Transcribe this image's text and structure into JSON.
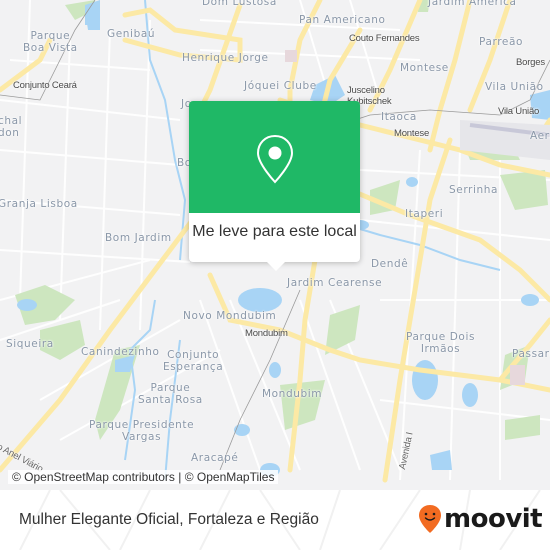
{
  "map": {
    "neighborhoods": [
      {
        "id": "dom-lustosa",
        "label": "Dom Lustosa"
      },
      {
        "id": "jardim-america",
        "label": "Jardim América"
      },
      {
        "id": "parque-boa-vista",
        "label": "Parque\nBoa Vista"
      },
      {
        "id": "genibau",
        "label": "Genibaú"
      },
      {
        "id": "pan-americano",
        "label": "Pan Americano"
      },
      {
        "id": "parreao",
        "label": "Parreão"
      },
      {
        "id": "henrique-jorge",
        "label": "Henrique Jorge"
      },
      {
        "id": "montese",
        "label": "Montese"
      },
      {
        "id": "joquei-clube",
        "label": "Jóquei Clube"
      },
      {
        "id": "vila-uniao",
        "label": "Vila União"
      },
      {
        "id": "itaoca",
        "label": "Itaoca"
      },
      {
        "id": "aeroporto",
        "label": "Aero"
      },
      {
        "id": "marechal-rondon",
        "label": "chal\ndon"
      },
      {
        "id": "serrinha",
        "label": "Serrinha"
      },
      {
        "id": "granja-lisboa",
        "label": "Granja Lisboa"
      },
      {
        "id": "itaperi",
        "label": "Itaperi"
      },
      {
        "id": "bom-jardim",
        "label": "Bom Jardim"
      },
      {
        "id": "dende",
        "label": "Dendê"
      },
      {
        "id": "jardim-cearense",
        "label": "Jardim Cearense"
      },
      {
        "id": "novo-mondubim",
        "label": "Novo Mondubim"
      },
      {
        "id": "parque-dois-irmaos",
        "label": "Parque Dois\nIrmãos"
      },
      {
        "id": "siqueira",
        "label": "Siqueira"
      },
      {
        "id": "canindezinho",
        "label": "Canindezinho"
      },
      {
        "id": "conjunto-esperanca",
        "label": "Conjunto\nEsperança"
      },
      {
        "id": "passare",
        "label": "Passare"
      },
      {
        "id": "parque-santa-rosa",
        "label": "Parque\nSanta Rosa"
      },
      {
        "id": "mondubim",
        "label": "Mondubim"
      },
      {
        "id": "parque-presidente-vargas",
        "label": "Parque Presidente\nVargas"
      },
      {
        "id": "aracape",
        "label": "Aracapé"
      },
      {
        "id": "partial-jo",
        "label": "Jo"
      },
      {
        "id": "partial-bo",
        "label": "Bo"
      }
    ],
    "stations": [
      {
        "id": "conjunto-ceara",
        "label": "Conjunto Ceará"
      },
      {
        "id": "couto-fernandes",
        "label": "Couto Fernandes"
      },
      {
        "id": "juscelino-kubitschek",
        "label": "Juscelino\nKubitschek"
      },
      {
        "id": "borges",
        "label": "Borges"
      },
      {
        "id": "vila-uniao-station",
        "label": "Vila União"
      },
      {
        "id": "montese-station",
        "label": "Montese"
      },
      {
        "id": "mondubim-station",
        "label": "Mondubim"
      }
    ],
    "roads": [
      {
        "id": "anel-viario",
        "label": "to Anel Viário"
      },
      {
        "id": "avenida-i",
        "label": "Avenida I"
      }
    ],
    "attribution": "© OpenStreetMap contributors | © OpenMapTiles"
  },
  "popup": {
    "icon": "location-pin-icon",
    "label": "Me leve para este local",
    "color": "#1fb866"
  },
  "footer": {
    "title": "Mulher Elegante Oficial, Fortaleza e Região",
    "logo_text": "moovit",
    "logo_color": "#f26b21"
  },
  "colors": {
    "land": "#f2f2f3",
    "road_major": "#fce9a5",
    "road_minor": "#ffffff",
    "water": "#a8d4f5",
    "park": "#cde6bf",
    "label": "#8a97a8"
  }
}
